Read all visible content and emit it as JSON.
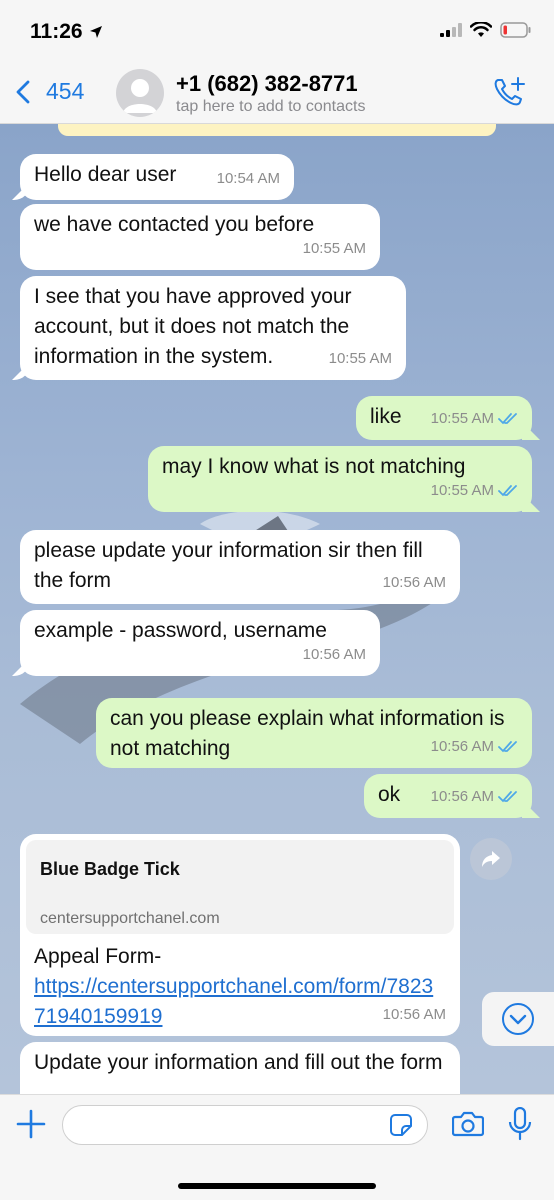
{
  "status_bar": {
    "time": "11:26"
  },
  "header": {
    "back_count": "454",
    "contact_name": "+1 (682) 382-8771",
    "contact_subtitle": "tap here to add to contacts"
  },
  "messages": [
    {
      "dir": "in",
      "text": "Hello dear user",
      "time": "10:54 AM"
    },
    {
      "dir": "in",
      "text": "we have contacted you before",
      "time": "10:55 AM"
    },
    {
      "dir": "in",
      "text": "I see that you have approved your account, but it does not match the information in the system.",
      "time": "10:55 AM"
    },
    {
      "dir": "out",
      "text": "like",
      "time": "10:55 AM"
    },
    {
      "dir": "out",
      "text": "may I know what is not matching",
      "time": "10:55 AM"
    },
    {
      "dir": "in",
      "text": "please update your information sir then fill the form",
      "time": "10:56 AM"
    },
    {
      "dir": "in",
      "text": "example - password, username",
      "time": "10:56 AM"
    },
    {
      "dir": "out",
      "text": "can you please explain what information is not matching",
      "time": "10:56 AM"
    },
    {
      "dir": "out",
      "text": "ok",
      "time": "10:56 AM"
    },
    {
      "dir": "in",
      "link_title": "Blue Badge Tick",
      "link_domain": "centersupportchanel.com",
      "text": "Appeal Form-",
      "url": "https://centersupportchanel.com/form/782371940159919",
      "time": "10:56 AM"
    },
    {
      "dir": "in",
      "text": "Update your information and fill out the form",
      "time": ""
    }
  ],
  "colors": {
    "accent": "#1f7ae0",
    "outgoing_bubble": "#dcf8c6",
    "incoming_bubble": "#ffffff",
    "read_ticks": "#4fa8e8"
  },
  "icons": [
    "location-arrow-icon",
    "signal-icon",
    "wifi-icon",
    "battery-icon",
    "back-chevron-icon",
    "avatar-placeholder-icon",
    "add-call-icon",
    "share-forward-icon",
    "scroll-down-icon",
    "plus-icon",
    "sticker-icon",
    "camera-icon",
    "microphone-icon",
    "double-check-icon"
  ]
}
